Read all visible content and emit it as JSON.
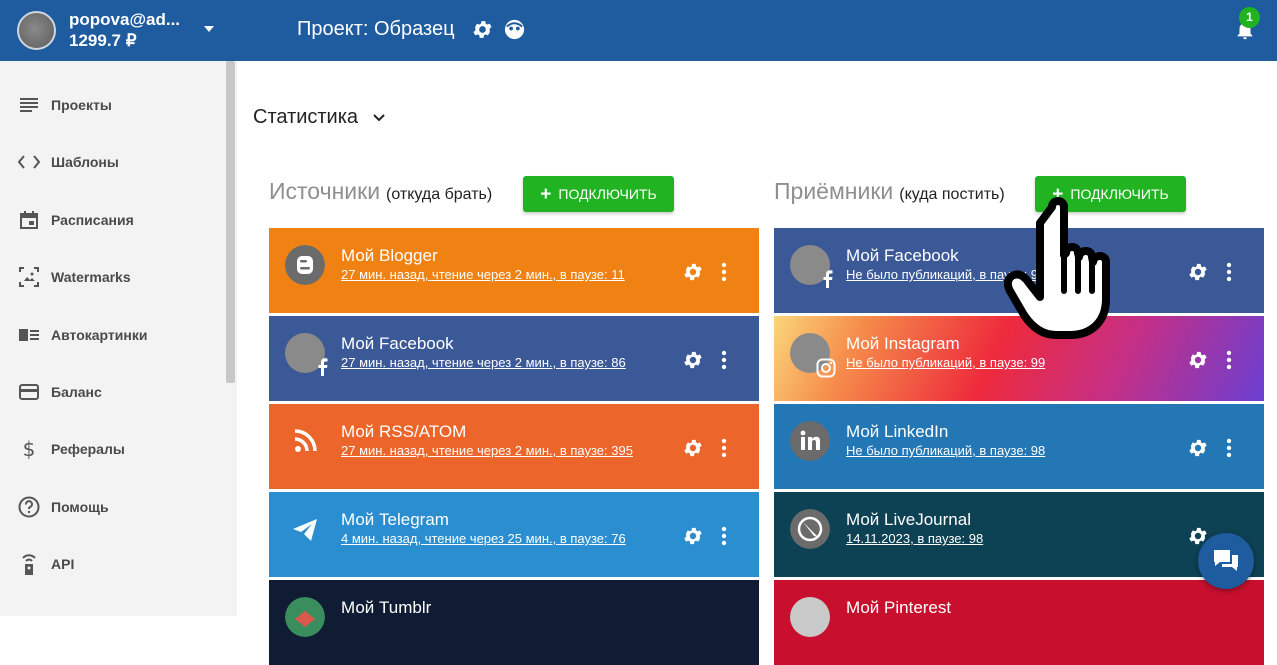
{
  "header": {
    "user_email": "popova@ad...",
    "user_balance": "1299.7 ₽",
    "project_title": "Проект: Образец",
    "notifications_count": "1"
  },
  "sidebar": {
    "items": [
      {
        "label": "Проекты",
        "icon": "list-icon"
      },
      {
        "label": "Шаблоны",
        "icon": "code-icon"
      },
      {
        "label": "Расписания",
        "icon": "calendar-icon"
      },
      {
        "label": "Watermarks",
        "icon": "watermark-icon"
      },
      {
        "label": "Автокартинки",
        "icon": "auto-image-icon"
      },
      {
        "label": "Баланс",
        "icon": "credit-card-icon"
      },
      {
        "label": "Рефералы",
        "icon": "dollar-icon"
      },
      {
        "label": "Помощь",
        "icon": "help-icon"
      },
      {
        "label": "API",
        "icon": "api-icon"
      }
    ]
  },
  "main": {
    "section_title": "Статистика",
    "sources": {
      "title": "Источники",
      "subtitle": "(откуда брать)",
      "connect_label": "ПОДКЛЮЧИТЬ",
      "cards": [
        {
          "title": "Мой Blogger",
          "status": "27 мин. назад, чтение через 2 мин., в паузе: 11",
          "color": "#f08113",
          "icon": "blogger-icon"
        },
        {
          "title": "Мой Facebook",
          "status": "27 мин. назад, чтение через 2 мин., в паузе: 86",
          "color": "#3b5997",
          "icon": "facebook-icon"
        },
        {
          "title": "Мой RSS/ATOM",
          "status": "27 мин. назад, чтение через 2 мин., в паузе: 395",
          "color": "#ec652a",
          "icon": "rss-icon"
        },
        {
          "title": "Мой Telegram",
          "status": "4 мин. назад, чтение через 25 мин., в паузе: 76",
          "color": "#2a8ed0",
          "icon": "telegram-icon"
        },
        {
          "title": "Мой Tumblr",
          "status": "",
          "color": "#0f1c34",
          "icon": "tumblr-icon"
        }
      ]
    },
    "receivers": {
      "title": "Приёмники",
      "subtitle": "(куда постить)",
      "connect_label": "ПОДКЛЮЧИТЬ",
      "cards": [
        {
          "title": "Мой Facebook",
          "status": "Не было публикаций, в паузе: 99",
          "color": "#3b5997",
          "icon": "facebook-icon"
        },
        {
          "title": "Мой Instagram",
          "status": "Не было публикаций, в паузе: 99",
          "color": "#e8334d",
          "icon": "instagram-icon"
        },
        {
          "title": "Мой LinkedIn",
          "status": "Не было публикаций, в паузе: 98",
          "color": "#2377b5",
          "icon": "linkedin-icon"
        },
        {
          "title": "Мой LiveJournal",
          "status": "14.11.2023, в паузе: 98",
          "color": "#0d4154",
          "icon": "livejournal-icon"
        },
        {
          "title": "Мой Pinterest",
          "status": "",
          "color": "#c8102e",
          "icon": "pinterest-icon"
        }
      ]
    }
  },
  "colors": {
    "header_bg": "#1f5b9f",
    "accent_green": "#21b321",
    "sidebar_bg": "#f3f3f3"
  }
}
